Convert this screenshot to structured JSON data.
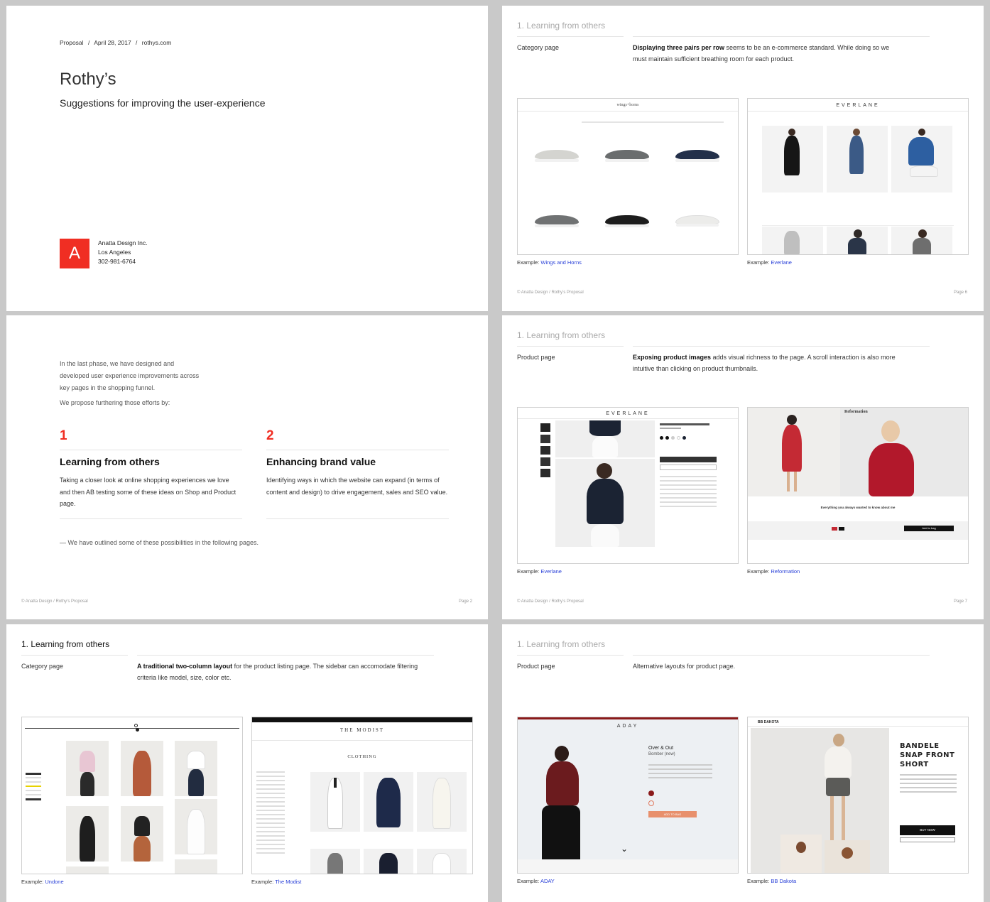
{
  "cover": {
    "breadcrumb": {
      "proposal": "Proposal",
      "date": "April 28, 2017",
      "site": "rothys.com",
      "sep": "/"
    },
    "title": "Rothy’s",
    "subtitle": "Suggestions for improving the user-experience",
    "logo_letter": "A",
    "company": {
      "name": "Anatta Design Inc.",
      "city": "Los Angeles",
      "phone": "302-981-6764"
    },
    "logo_color": "#f02e23"
  },
  "intro": {
    "para1": "In the last phase, we have designed and developed user experience improvements across key pages in the shopping funnel.",
    "para2": "We propose furthering those efforts by:",
    "items": [
      {
        "num": "1",
        "title": "Learning from others",
        "body": "Taking a closer look at online shopping experiences we love and then AB testing some of these ideas on Shop and Product page."
      },
      {
        "num": "2",
        "title": "Enhancing brand value",
        "body": "Identifying ways in which the website can expand (in terms of content and design) to drive engagement, sales and SEO value."
      }
    ],
    "outro": "— We  have outlined some of these possibilities in the following pages.",
    "footer": "© Anatta Design / Rothy’s Proposal",
    "page": "Page 2",
    "accent": "#f02e23"
  },
  "page3": {
    "section": "1. Learning from others",
    "label": "Category page",
    "body_bold": "A traditional two-column layout",
    "body_rest": " for the product listing page. The sidebar can accomodate filtering criteria like model, size, color etc.",
    "captions": [
      {
        "prefix": "Example: ",
        "link": "Undone"
      },
      {
        "prefix": "Example: ",
        "link": "The Modist"
      }
    ]
  },
  "page6": {
    "section": "1. Learning from others",
    "label": "Category page",
    "body_bold": "Displaying three pairs per row",
    "body_rest": " seems to be an e-commerce standard. While doing so we must maintain sufficient breathing room for each product.",
    "captions": [
      {
        "prefix": "Example: ",
        "link": "Wings and Horns"
      },
      {
        "prefix": "Example: ",
        "link": "Everlane"
      }
    ],
    "footer": "© Anatta Design / Rothy’s Proposal",
    "page": "Page 6"
  },
  "page7": {
    "section": "1. Learning from others",
    "label": "Product page",
    "body_bold": "Exposing product images",
    "body_rest": " adds visual richness to the page. A scroll interaction is also more intuitive than clicking on product thumbnails.",
    "captions": [
      {
        "prefix": "Example: ",
        "link": "Everlane"
      },
      {
        "prefix": "Example: ",
        "link": "Reformation"
      }
    ],
    "footer": "© Anatta Design / Rothy’s Proposal",
    "page": "Page 7"
  },
  "page8": {
    "section": "1. Learning from others",
    "label": "Product page",
    "body": "Alternative layouts for product page.",
    "captions": [
      {
        "prefix": "Example: ",
        "link": "ADAY"
      },
      {
        "prefix": "Example: ",
        "link": "BB Dakota"
      }
    ]
  },
  "shots": {
    "wings": {
      "logo": "wings+horns"
    },
    "everlane": {
      "logo": "EVERLANE"
    },
    "modist": {
      "logo": "THE MODIST",
      "heading": "CLOTHING"
    },
    "reformation": {
      "logo": "Reformation",
      "tagline": "Everything you always wanted to know about me",
      "cta": "Add to bag"
    },
    "aday": {
      "logo": "ADAY",
      "product": "Over & Out",
      "subproduct": "Bomber (new)",
      "cta": "ADD TO BAG"
    },
    "bbdakota": {
      "logo": "BB DAKOTA",
      "product": "BANDELE SNAP FRONT SHORT",
      "cta": "BUY NOW"
    }
  }
}
